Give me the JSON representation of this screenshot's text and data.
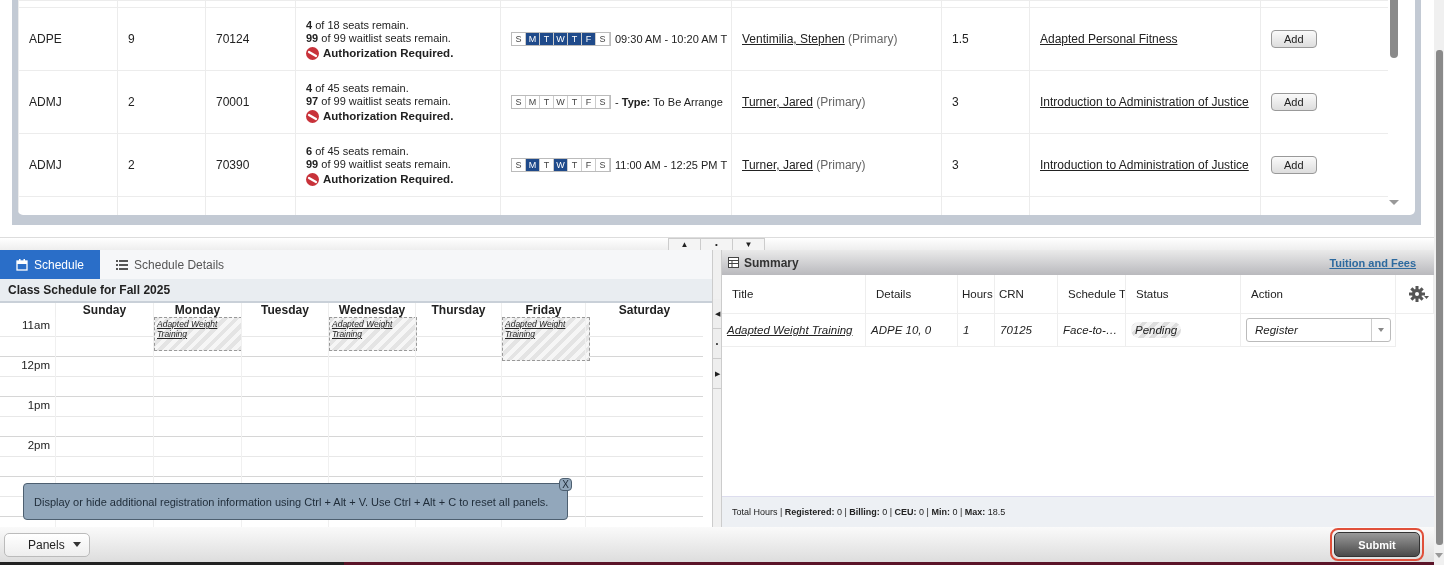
{
  "sections": {
    "rows": [
      {
        "subject": "ADPE",
        "course": "9",
        "crn": "70124",
        "seats": [
          "**4** of 18 seats remain.",
          "**99** of 99 waitlist seats remain."
        ],
        "authorization": "Authorization Required.",
        "days": [
          {
            "label": "S",
            "selected": false
          },
          {
            "label": "M",
            "selected": true
          },
          {
            "label": "T",
            "selected": true
          },
          {
            "label": "W",
            "selected": true
          },
          {
            "label": "T",
            "selected": true
          },
          {
            "label": "F",
            "selected": true
          },
          {
            "label": "S",
            "selected": false
          }
        ],
        "meeting": "09:30 AM - 10:20 AM T",
        "instructor": "Ventimilia, Stephen",
        "role": "(Primary)",
        "hours": "1.5",
        "title": "Adapted Personal Fitness",
        "action": "Add"
      },
      {
        "subject": "ADMJ",
        "course": "2",
        "crn": "70001",
        "seats": [
          "**4** of 45 seats remain.",
          "**97** of 99 waitlist seats remain."
        ],
        "authorization": "Authorization Required.",
        "days": [
          {
            "label": "S",
            "selected": false
          },
          {
            "label": "M",
            "selected": false
          },
          {
            "label": "T",
            "selected": false
          },
          {
            "label": "W",
            "selected": false
          },
          {
            "label": "T",
            "selected": false
          },
          {
            "label": "F",
            "selected": false
          },
          {
            "label": "S",
            "selected": false
          }
        ],
        "meeting": " - **Type:** To Be Arrange",
        "instructor": "Turner, Jared",
        "role": "(Primary)",
        "hours": "3",
        "title": "Introduction to Administration of Justice",
        "action": "Add"
      },
      {
        "subject": "ADMJ",
        "course": "2",
        "crn": "70390",
        "seats": [
          "**6** of 45 seats remain.",
          "**99** of 99 waitlist seats remain."
        ],
        "authorization": "Authorization Required.",
        "days": [
          {
            "label": "S",
            "selected": false
          },
          {
            "label": "M",
            "selected": true
          },
          {
            "label": "T",
            "selected": false
          },
          {
            "label": "W",
            "selected": true
          },
          {
            "label": "T",
            "selected": false
          },
          {
            "label": "F",
            "selected": false
          },
          {
            "label": "S",
            "selected": false
          }
        ],
        "meeting": "11:00 AM - 12:25 PM T",
        "instructor": "Turner, Jared",
        "role": "(Primary)",
        "hours": "3",
        "title": "Introduction to Administration of Justice",
        "action": "Add"
      }
    ]
  },
  "splitter": {
    "buttons": [
      "▲",
      "•",
      "▼"
    ]
  },
  "side_splitter": {
    "buttons": [
      "◀",
      "•",
      "▶"
    ]
  },
  "schedule": {
    "tabs": [
      {
        "label": "Schedule",
        "selected": true,
        "kind": "calendar"
      },
      {
        "label": "Schedule Details",
        "selected": false,
        "kind": "list"
      }
    ],
    "title": "Class Schedule for Fall 2025",
    "days": [
      {
        "name": "Sunday"
      },
      {
        "name": "Monday",
        "events": [
          {
            "title": "Adapted Weight Training",
            "extended": false
          }
        ]
      },
      {
        "name": "Tuesday"
      },
      {
        "name": "Wednesday",
        "events": [
          {
            "title": "Adapted Weight Training",
            "extended": false
          }
        ]
      },
      {
        "name": "Thursday"
      },
      {
        "name": "Friday",
        "events": [
          {
            "title": "Adapted Weight Training",
            "extended": true
          }
        ]
      },
      {
        "name": "Saturday"
      }
    ],
    "times": [
      "11am",
      "12pm",
      "1pm",
      "2pm"
    ],
    "tooltip": {
      "text": "Display or hide additional registration information using Ctrl + Alt + V. Use Ctrl + Alt + C to reset all panels.",
      "close": "X"
    }
  },
  "summary": {
    "title": "Summary",
    "link": "Tuition and Fees",
    "columns": [
      "Title",
      "Details",
      "Hours",
      "CRN",
      "Schedule T",
      "Status",
      "Action"
    ],
    "rows": [
      {
        "title": "Adapted Weight Training",
        "details": "ADPE 10, 0",
        "hours": "1",
        "crn": "70125",
        "schedule_type": "Face-to-…",
        "status": "Pending",
        "action": "Register"
      }
    ],
    "totals": "Total Hours | **Registered:** 0 | **Billing:** 0 | **CEU:** 0 | **Min:** 0 | **Max:** 18.5"
  },
  "footer": {
    "panels_button": "Panels",
    "submit_button": "Submit",
    "submit_highlighted": true
  }
}
